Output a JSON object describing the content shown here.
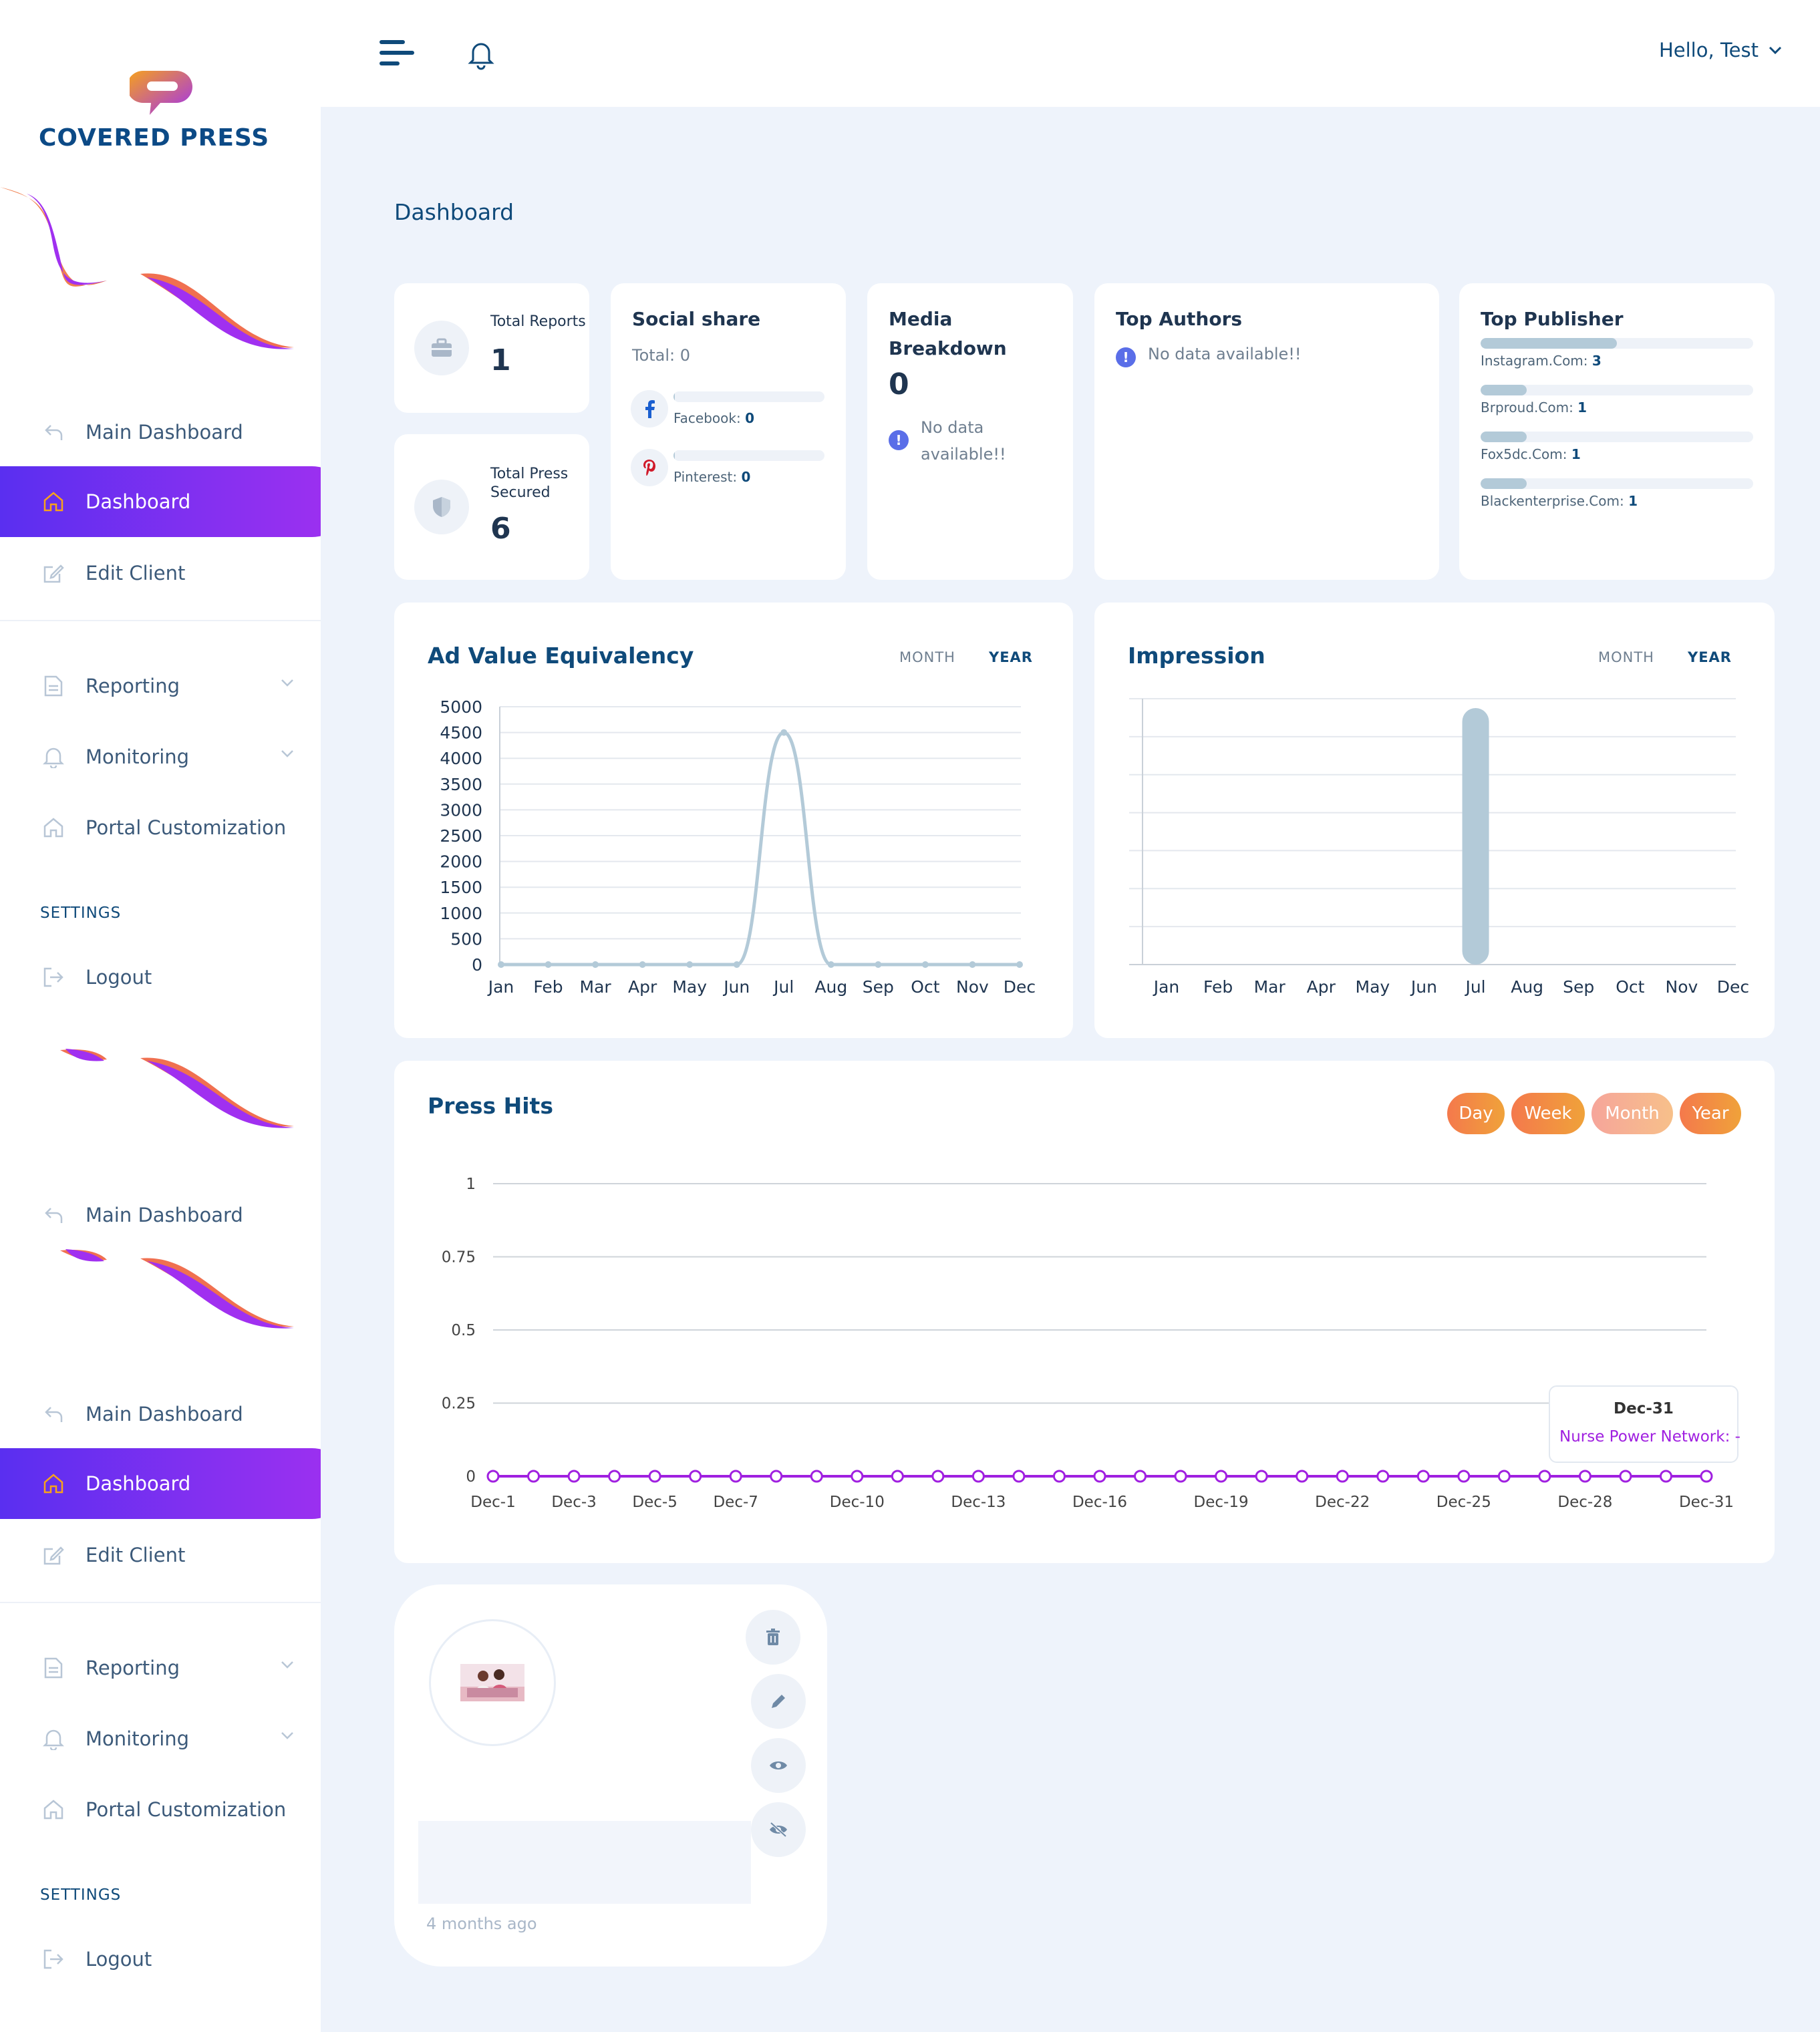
{
  "brand": {
    "name": "COVERED PRESS"
  },
  "sidebar": {
    "groups": [
      {
        "items": [
          {
            "label": "Main Dashboard",
            "icon": "back-arrow-icon"
          },
          {
            "label": "Dashboard",
            "icon": "home-icon",
            "active": true
          },
          {
            "label": "Edit Client",
            "icon": "edit-icon"
          }
        ],
        "menu": [
          {
            "label": "Reporting",
            "icon": "document-icon"
          },
          {
            "label": "Monitoring",
            "icon": "bell-icon"
          },
          {
            "label": "Portal Customization",
            "icon": "home-icon"
          }
        ],
        "settings_label": "SETTINGS",
        "logout": "Logout"
      }
    ],
    "repeat": {
      "main_dashboard": "Main Dashboard",
      "main_dashboard_2": "Main Dashboard",
      "dashboard": "Dashboard",
      "edit_client": "Edit Client",
      "reporting": "Reporting",
      "monitoring": "Monitoring",
      "portal": "Portal Customization",
      "settings_label": "SETTINGS",
      "logout": "Logout"
    }
  },
  "topbar": {
    "greeting": "Hello, Test"
  },
  "page": {
    "title": "Dashboard"
  },
  "stats": {
    "total_reports": {
      "label": "Total Reports",
      "value": "1"
    },
    "total_press": {
      "label": "Total Press Secured",
      "value": "6"
    }
  },
  "social": {
    "title": "Social share",
    "total": "Total: 0",
    "items": [
      {
        "name": "Facebook:",
        "value": "0",
        "fraction": 0.01
      },
      {
        "name": "Pinterest:",
        "value": "0",
        "fraction": 0.01
      }
    ]
  },
  "media": {
    "title": "Media Breakdown",
    "value": "0",
    "empty": "No data available!!"
  },
  "authors": {
    "title": "Top Authors",
    "empty": "No data available!!"
  },
  "publishers": {
    "title": "Top Publisher",
    "items": [
      {
        "name": "Instagram.Com:",
        "value": "3",
        "fraction": 0.5
      },
      {
        "name": "Brproud.Com:",
        "value": "1",
        "fraction": 0.17
      },
      {
        "name": "Fox5dc.Com:",
        "value": "1",
        "fraction": 0.17
      },
      {
        "name": "Blackenterprise.Com:",
        "value": "1",
        "fraction": 0.17
      }
    ]
  },
  "toggles": {
    "month": "MONTH",
    "year": "YEAR"
  },
  "ad_chart_title": "Ad Value Equivalency",
  "impression_chart_title": "Impression",
  "press_chart_title": "Press Hits",
  "press_filters": [
    "Day",
    "Week",
    "Month",
    "Year"
  ],
  "tooltip": {
    "date": "Dec-31",
    "line": "Nurse Power Network: -"
  },
  "post": {
    "time": "4 months ago"
  },
  "colors": {
    "accent_start": "#5a2ff0",
    "accent_end": "#a030f0",
    "series_light": "#b3cad8",
    "series_purple": "#a020e0",
    "brand_blue": "#0c4a86",
    "brand_orange": "#f08030"
  },
  "chart_data": [
    {
      "type": "line",
      "title": "Ad Value Equivalency",
      "categories": [
        "Jan",
        "Feb",
        "Mar",
        "Apr",
        "May",
        "Jun",
        "Jul",
        "Aug",
        "Sep",
        "Oct",
        "Nov",
        "Dec"
      ],
      "values": [
        0,
        0,
        0,
        0,
        0,
        0,
        4500,
        0,
        0,
        0,
        0,
        0
      ],
      "ylim": [
        0,
        5000
      ],
      "yticks": [
        "5000",
        "4500",
        "4000",
        "3500",
        "3000",
        "2500",
        "2000",
        "1500",
        "1000",
        "500",
        "0"
      ],
      "grid": true
    },
    {
      "type": "bar",
      "title": "Impression",
      "categories": [
        "Jan",
        "Feb",
        "Mar",
        "Apr",
        "May",
        "Jun",
        "Jul",
        "Aug",
        "Sep",
        "Oct",
        "Nov",
        "Dec"
      ],
      "values": [
        0,
        0,
        0,
        0,
        0,
        0,
        1,
        0,
        0,
        0,
        0,
        0
      ],
      "ylim": [
        0,
        1
      ],
      "grid": true
    },
    {
      "type": "line",
      "title": "Press Hits",
      "series": [
        {
          "name": "Nurse Power Network",
          "values": [
            0,
            0,
            0,
            0,
            0,
            0,
            0,
            0,
            0,
            0,
            0,
            0,
            0,
            0,
            0,
            0,
            0,
            0,
            0,
            0,
            0,
            0,
            0,
            0,
            0,
            0,
            0,
            0,
            0,
            0,
            0
          ]
        }
      ],
      "x": [
        "Dec-1",
        "Dec-2",
        "Dec-3",
        "Dec-4",
        "Dec-5",
        "Dec-6",
        "Dec-7",
        "Dec-8",
        "Dec-9",
        "Dec-10",
        "Dec-11",
        "Dec-12",
        "Dec-13",
        "Dec-14",
        "Dec-15",
        "Dec-16",
        "Dec-17",
        "Dec-18",
        "Dec-19",
        "Dec-20",
        "Dec-21",
        "Dec-22",
        "Dec-23",
        "Dec-24",
        "Dec-25",
        "Dec-26",
        "Dec-27",
        "Dec-28",
        "Dec-29",
        "Dec-30",
        "Dec-31"
      ],
      "xticks": [
        "Dec-1",
        "Dec-3",
        "Dec-5",
        "Dec-7",
        "Dec-10",
        "Dec-13",
        "Dec-16",
        "Dec-19",
        "Dec-22",
        "Dec-25",
        "Dec-28",
        "Dec-31"
      ],
      "ylim": [
        0,
        1
      ],
      "yticks": [
        "1",
        "0.75",
        "0.5",
        "0.25",
        "0"
      ],
      "grid": true
    }
  ]
}
